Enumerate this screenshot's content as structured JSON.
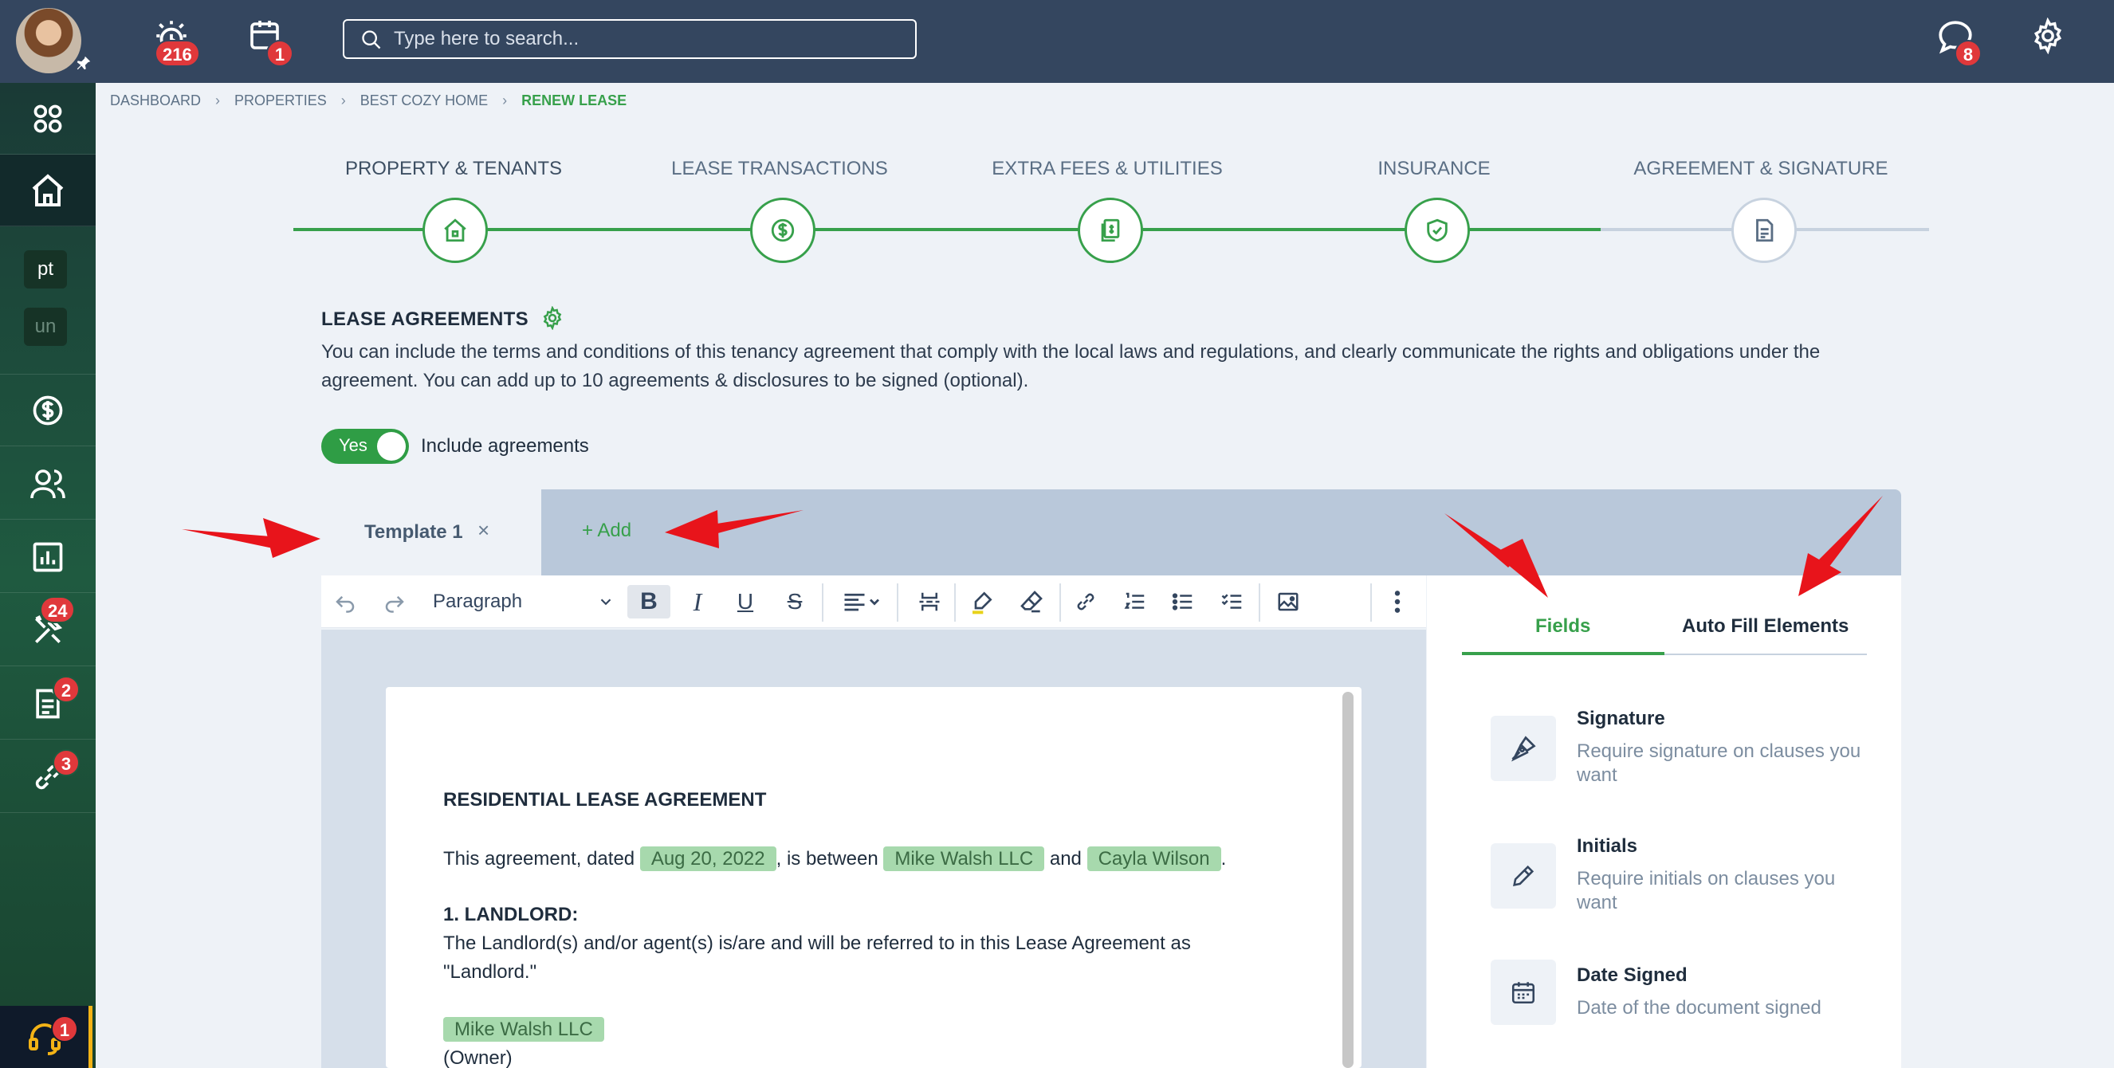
{
  "topbar": {
    "alarm_count": "216",
    "calendar_count": "1",
    "search_placeholder": "Type here to search...",
    "chat_count": "8"
  },
  "sidebar": {
    "chip_pt": "pt",
    "chip_un": "un",
    "tools_count": "24",
    "docs_count": "2",
    "links_count": "3",
    "help_count": "1"
  },
  "breadcrumb": [
    "DASHBOARD",
    "PROPERTIES",
    "BEST COZY HOME",
    "RENEW LEASE"
  ],
  "steps": [
    "PROPERTY & TENANTS",
    "LEASE TRANSACTIONS",
    "EXTRA FEES & UTILITIES",
    "INSURANCE",
    "AGREEMENT & SIGNATURE"
  ],
  "lease": {
    "heading": "LEASE AGREEMENTS",
    "description": "You can include the terms and conditions of this tenancy agreement that comply with the local laws and regulations, and clearly communicate the rights and obligations under the agreement. You can add up to 10 agreements & disclosures to be signed (optional).",
    "toggle_label": "Yes",
    "include_label": "Include agreements"
  },
  "tabs": {
    "template_label": "Template 1",
    "close": "×",
    "add_label": "+ Add"
  },
  "toolbar": {
    "paragraph": "Paragraph"
  },
  "document": {
    "title": "RESIDENTIAL LEASE AGREEMENT",
    "line1_a": "This agreement, dated",
    "date": "Aug 20, 2022",
    "line1_b": ", is between",
    "landlord": "Mike Walsh LLC",
    "and": "and",
    "tenant": "Cayla Wilson",
    "dot": ".",
    "section1": "1. LANDLORD:",
    "section1_text": "The Landlord(s) and/or agent(s) is/are and will be referred to in this Lease Agreement as \"Landlord.\"",
    "owner_name": "Mike Walsh LLC",
    "owner_label": "(Owner)"
  },
  "right_panel": {
    "tab_fields": "Fields",
    "tab_auto": "Auto Fill Elements",
    "fields": [
      {
        "title": "Signature",
        "desc": "Require signature on clauses you want"
      },
      {
        "title": "Initials",
        "desc": "Require initials on clauses you want"
      },
      {
        "title": "Date Signed",
        "desc": "Date of the document signed"
      }
    ]
  },
  "colors": {
    "topbar": "#34465f",
    "accent_green": "#37a04b",
    "badge_red": "#e0383b",
    "annotation_red": "#e8141b"
  }
}
